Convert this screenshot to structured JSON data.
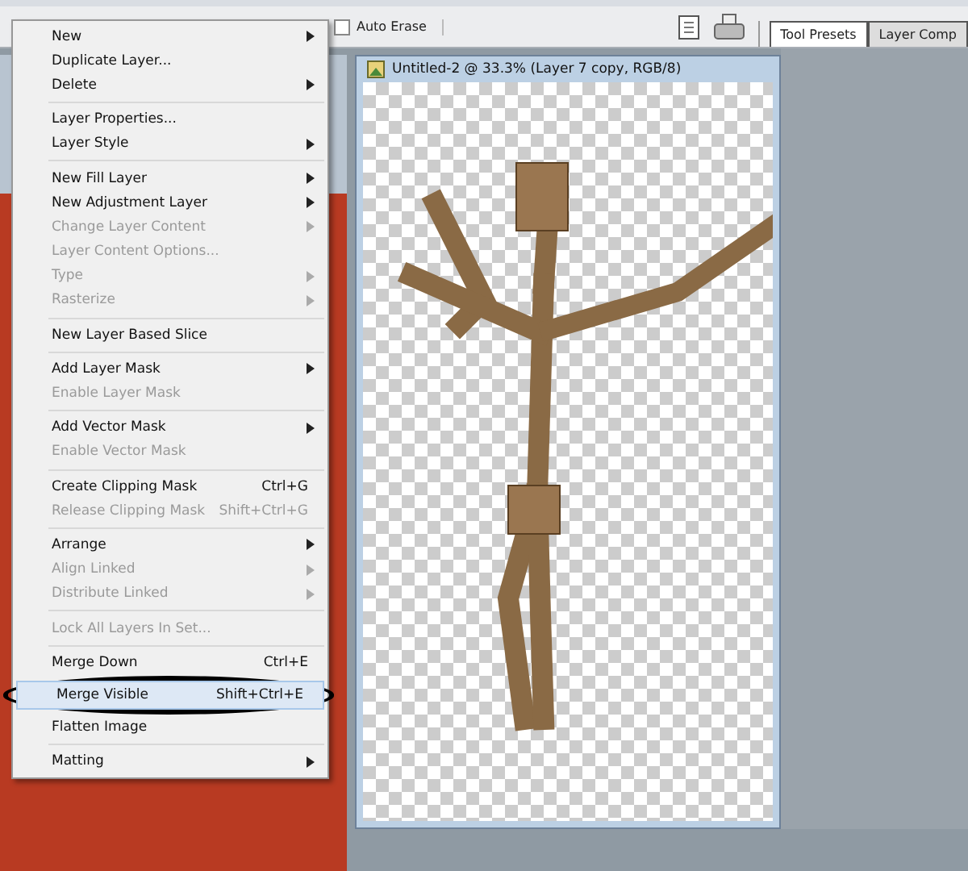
{
  "options_bar": {
    "auto_erase": {
      "label": "Auto Erase",
      "checked": false
    }
  },
  "panel_tabs": [
    {
      "label": "Tool Presets",
      "selected": true
    },
    {
      "label": "Layer Comp",
      "selected": false
    }
  ],
  "document": {
    "title": "Untitled-2 @ 33.3% (Layer 7 copy, RGB/8)"
  },
  "menu": {
    "items": [
      {
        "kind": "item",
        "label": "New",
        "submenu": true,
        "disabled": false,
        "selected": false
      },
      {
        "kind": "item",
        "label": "Duplicate Layer...",
        "submenu": false,
        "disabled": false,
        "selected": false
      },
      {
        "kind": "item",
        "label": "Delete",
        "submenu": true,
        "disabled": false,
        "selected": false
      },
      {
        "kind": "separator"
      },
      {
        "kind": "item",
        "label": "Layer Properties...",
        "submenu": false,
        "disabled": false,
        "selected": false
      },
      {
        "kind": "item",
        "label": "Layer Style",
        "submenu": true,
        "disabled": false,
        "selected": false
      },
      {
        "kind": "separator"
      },
      {
        "kind": "item",
        "label": "New Fill Layer",
        "submenu": true,
        "disabled": false,
        "selected": false
      },
      {
        "kind": "item",
        "label": "New Adjustment Layer",
        "submenu": true,
        "disabled": false,
        "selected": false
      },
      {
        "kind": "item",
        "label": "Change Layer Content",
        "submenu": true,
        "disabled": true,
        "selected": false
      },
      {
        "kind": "item",
        "label": "Layer Content Options...",
        "submenu": false,
        "disabled": true,
        "selected": false
      },
      {
        "kind": "item",
        "label": "Type",
        "submenu": true,
        "disabled": true,
        "selected": false
      },
      {
        "kind": "item",
        "label": "Rasterize",
        "submenu": true,
        "disabled": true,
        "selected": false
      },
      {
        "kind": "separator"
      },
      {
        "kind": "item",
        "label": "New Layer Based Slice",
        "submenu": false,
        "disabled": false,
        "selected": false
      },
      {
        "kind": "separator"
      },
      {
        "kind": "item",
        "label": "Add Layer Mask",
        "submenu": true,
        "disabled": false,
        "selected": false
      },
      {
        "kind": "item",
        "label": "Enable Layer Mask",
        "submenu": false,
        "disabled": true,
        "selected": false
      },
      {
        "kind": "separator"
      },
      {
        "kind": "item",
        "label": "Add Vector Mask",
        "submenu": true,
        "disabled": false,
        "selected": false
      },
      {
        "kind": "item",
        "label": "Enable Vector Mask",
        "submenu": false,
        "disabled": true,
        "selected": false
      },
      {
        "kind": "separator"
      },
      {
        "kind": "item",
        "label": "Create Clipping Mask",
        "shortcut": "Ctrl+G",
        "submenu": false,
        "disabled": false,
        "selected": false
      },
      {
        "kind": "item",
        "label": "Release Clipping Mask",
        "shortcut": "Shift+Ctrl+G",
        "submenu": false,
        "disabled": true,
        "selected": false
      },
      {
        "kind": "separator"
      },
      {
        "kind": "item",
        "label": "Arrange",
        "submenu": true,
        "disabled": false,
        "selected": false
      },
      {
        "kind": "item",
        "label": "Align Linked",
        "submenu": true,
        "disabled": true,
        "selected": false
      },
      {
        "kind": "item",
        "label": "Distribute Linked",
        "submenu": true,
        "disabled": true,
        "selected": false
      },
      {
        "kind": "separator"
      },
      {
        "kind": "item",
        "label": "Lock All Layers In Set...",
        "submenu": false,
        "disabled": true,
        "selected": false
      },
      {
        "kind": "separator"
      },
      {
        "kind": "item",
        "label": "Merge Down",
        "shortcut": "Ctrl+E",
        "submenu": false,
        "disabled": false,
        "selected": false
      },
      {
        "kind": "item",
        "label": "Merge Visible",
        "shortcut": "Shift+Ctrl+E",
        "submenu": false,
        "disabled": false,
        "selected": true
      },
      {
        "kind": "item",
        "label": "Flatten Image",
        "submenu": false,
        "disabled": false,
        "selected": false
      },
      {
        "kind": "separator"
      },
      {
        "kind": "item",
        "label": "Matting",
        "submenu": true,
        "disabled": false,
        "selected": false
      }
    ]
  }
}
